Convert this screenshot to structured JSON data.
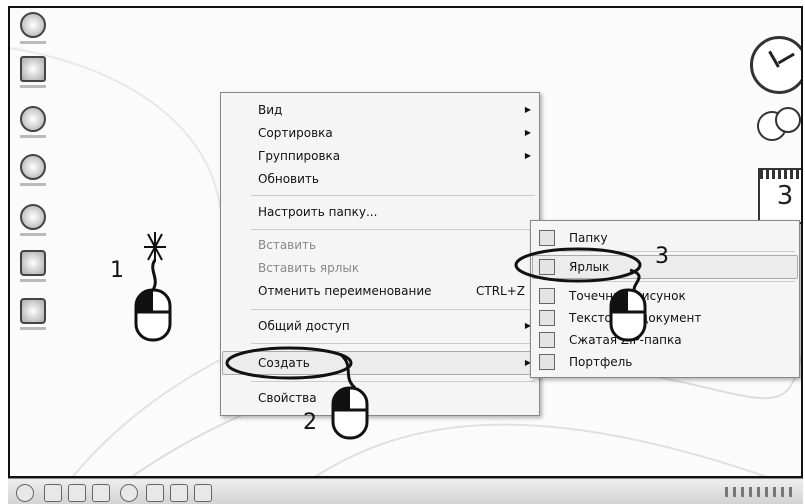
{
  "context_menu": {
    "items": [
      {
        "label": "Вид",
        "submenu": true,
        "disabled": false,
        "shortcut": ""
      },
      {
        "label": "Сортировка",
        "submenu": true,
        "disabled": false,
        "shortcut": ""
      },
      {
        "label": "Группировка",
        "submenu": true,
        "disabled": false,
        "shortcut": ""
      },
      {
        "label": "Обновить",
        "submenu": false,
        "disabled": false,
        "shortcut": ""
      },
      {
        "label": "Настроить папку...",
        "submenu": false,
        "disabled": false,
        "shortcut": ""
      },
      {
        "label": "Вставить",
        "submenu": false,
        "disabled": true,
        "shortcut": ""
      },
      {
        "label": "Вставить ярлык",
        "submenu": false,
        "disabled": true,
        "shortcut": ""
      },
      {
        "label": "Отменить переименование",
        "submenu": false,
        "disabled": false,
        "shortcut": "CTRL+Z"
      },
      {
        "label": "Общий доступ",
        "submenu": true,
        "disabled": false,
        "shortcut": ""
      },
      {
        "label": "Создать",
        "submenu": true,
        "disabled": false,
        "shortcut": ""
      },
      {
        "label": "Свойства",
        "submenu": false,
        "disabled": false,
        "shortcut": ""
      }
    ]
  },
  "create_submenu": {
    "items": [
      {
        "label": "Папку",
        "icon": "folder-icon"
      },
      {
        "label": "Ярлык",
        "icon": "shortcut-icon"
      },
      {
        "label": "Точечный рисунок",
        "icon": "bitmap-icon"
      },
      {
        "label": "Текстовый документ",
        "icon": "text-document-icon"
      },
      {
        "label": "Сжатая ZIP-папка",
        "icon": "zip-folder-icon"
      },
      {
        "label": "Портфель",
        "icon": "briefcase-icon"
      }
    ]
  },
  "steps": {
    "step1": "1",
    "step2": "2",
    "step3": "3"
  },
  "gadgets": {
    "calendar_day": "3"
  },
  "desktop_icons": [
    "computer-icon",
    "recycle-bin-icon",
    "network-icon",
    "browser-icon",
    "media-player-icon",
    "control-panel-icon",
    "documents-icon"
  ],
  "taskbar_icons": [
    "start-icon",
    "browser-icon",
    "folder-icon",
    "media-icon",
    "player-icon",
    "tool-icon",
    "app-icon",
    "app2-icon"
  ],
  "arrow_glyph": "▶"
}
